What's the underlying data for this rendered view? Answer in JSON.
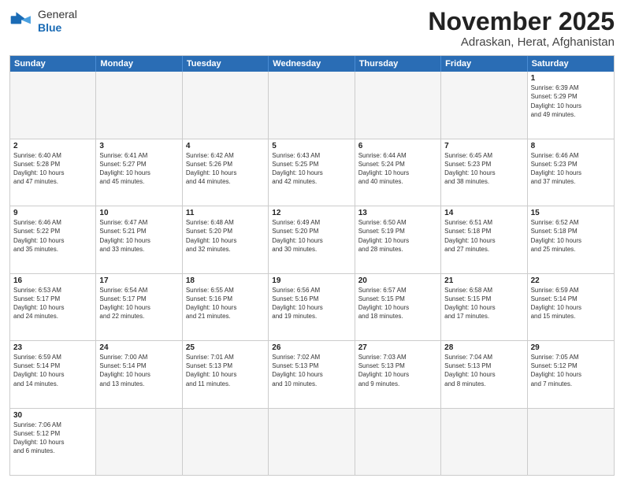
{
  "header": {
    "logo_general": "General",
    "logo_blue": "Blue",
    "month": "November 2025",
    "location": "Adraskan, Herat, Afghanistan"
  },
  "days_of_week": [
    "Sunday",
    "Monday",
    "Tuesday",
    "Wednesday",
    "Thursday",
    "Friday",
    "Saturday"
  ],
  "rows": [
    {
      "cells": [
        {
          "day": "",
          "info": ""
        },
        {
          "day": "",
          "info": ""
        },
        {
          "day": "",
          "info": ""
        },
        {
          "day": "",
          "info": ""
        },
        {
          "day": "",
          "info": ""
        },
        {
          "day": "",
          "info": ""
        },
        {
          "day": "1",
          "info": "Sunrise: 6:39 AM\nSunset: 5:29 PM\nDaylight: 10 hours\nand 49 minutes."
        }
      ]
    },
    {
      "cells": [
        {
          "day": "2",
          "info": "Sunrise: 6:40 AM\nSunset: 5:28 PM\nDaylight: 10 hours\nand 47 minutes."
        },
        {
          "day": "3",
          "info": "Sunrise: 6:41 AM\nSunset: 5:27 PM\nDaylight: 10 hours\nand 45 minutes."
        },
        {
          "day": "4",
          "info": "Sunrise: 6:42 AM\nSunset: 5:26 PM\nDaylight: 10 hours\nand 44 minutes."
        },
        {
          "day": "5",
          "info": "Sunrise: 6:43 AM\nSunset: 5:25 PM\nDaylight: 10 hours\nand 42 minutes."
        },
        {
          "day": "6",
          "info": "Sunrise: 6:44 AM\nSunset: 5:24 PM\nDaylight: 10 hours\nand 40 minutes."
        },
        {
          "day": "7",
          "info": "Sunrise: 6:45 AM\nSunset: 5:23 PM\nDaylight: 10 hours\nand 38 minutes."
        },
        {
          "day": "8",
          "info": "Sunrise: 6:46 AM\nSunset: 5:23 PM\nDaylight: 10 hours\nand 37 minutes."
        }
      ]
    },
    {
      "cells": [
        {
          "day": "9",
          "info": "Sunrise: 6:46 AM\nSunset: 5:22 PM\nDaylight: 10 hours\nand 35 minutes."
        },
        {
          "day": "10",
          "info": "Sunrise: 6:47 AM\nSunset: 5:21 PM\nDaylight: 10 hours\nand 33 minutes."
        },
        {
          "day": "11",
          "info": "Sunrise: 6:48 AM\nSunset: 5:20 PM\nDaylight: 10 hours\nand 32 minutes."
        },
        {
          "day": "12",
          "info": "Sunrise: 6:49 AM\nSunset: 5:20 PM\nDaylight: 10 hours\nand 30 minutes."
        },
        {
          "day": "13",
          "info": "Sunrise: 6:50 AM\nSunset: 5:19 PM\nDaylight: 10 hours\nand 28 minutes."
        },
        {
          "day": "14",
          "info": "Sunrise: 6:51 AM\nSunset: 5:18 PM\nDaylight: 10 hours\nand 27 minutes."
        },
        {
          "day": "15",
          "info": "Sunrise: 6:52 AM\nSunset: 5:18 PM\nDaylight: 10 hours\nand 25 minutes."
        }
      ]
    },
    {
      "cells": [
        {
          "day": "16",
          "info": "Sunrise: 6:53 AM\nSunset: 5:17 PM\nDaylight: 10 hours\nand 24 minutes."
        },
        {
          "day": "17",
          "info": "Sunrise: 6:54 AM\nSunset: 5:17 PM\nDaylight: 10 hours\nand 22 minutes."
        },
        {
          "day": "18",
          "info": "Sunrise: 6:55 AM\nSunset: 5:16 PM\nDaylight: 10 hours\nand 21 minutes."
        },
        {
          "day": "19",
          "info": "Sunrise: 6:56 AM\nSunset: 5:16 PM\nDaylight: 10 hours\nand 19 minutes."
        },
        {
          "day": "20",
          "info": "Sunrise: 6:57 AM\nSunset: 5:15 PM\nDaylight: 10 hours\nand 18 minutes."
        },
        {
          "day": "21",
          "info": "Sunrise: 6:58 AM\nSunset: 5:15 PM\nDaylight: 10 hours\nand 17 minutes."
        },
        {
          "day": "22",
          "info": "Sunrise: 6:59 AM\nSunset: 5:14 PM\nDaylight: 10 hours\nand 15 minutes."
        }
      ]
    },
    {
      "cells": [
        {
          "day": "23",
          "info": "Sunrise: 6:59 AM\nSunset: 5:14 PM\nDaylight: 10 hours\nand 14 minutes."
        },
        {
          "day": "24",
          "info": "Sunrise: 7:00 AM\nSunset: 5:14 PM\nDaylight: 10 hours\nand 13 minutes."
        },
        {
          "day": "25",
          "info": "Sunrise: 7:01 AM\nSunset: 5:13 PM\nDaylight: 10 hours\nand 11 minutes."
        },
        {
          "day": "26",
          "info": "Sunrise: 7:02 AM\nSunset: 5:13 PM\nDaylight: 10 hours\nand 10 minutes."
        },
        {
          "day": "27",
          "info": "Sunrise: 7:03 AM\nSunset: 5:13 PM\nDaylight: 10 hours\nand 9 minutes."
        },
        {
          "day": "28",
          "info": "Sunrise: 7:04 AM\nSunset: 5:13 PM\nDaylight: 10 hours\nand 8 minutes."
        },
        {
          "day": "29",
          "info": "Sunrise: 7:05 AM\nSunset: 5:12 PM\nDaylight: 10 hours\nand 7 minutes."
        }
      ]
    },
    {
      "cells": [
        {
          "day": "30",
          "info": "Sunrise: 7:06 AM\nSunset: 5:12 PM\nDaylight: 10 hours\nand 6 minutes."
        },
        {
          "day": "",
          "info": ""
        },
        {
          "day": "",
          "info": ""
        },
        {
          "day": "",
          "info": ""
        },
        {
          "day": "",
          "info": ""
        },
        {
          "day": "",
          "info": ""
        },
        {
          "day": "",
          "info": ""
        }
      ]
    }
  ]
}
